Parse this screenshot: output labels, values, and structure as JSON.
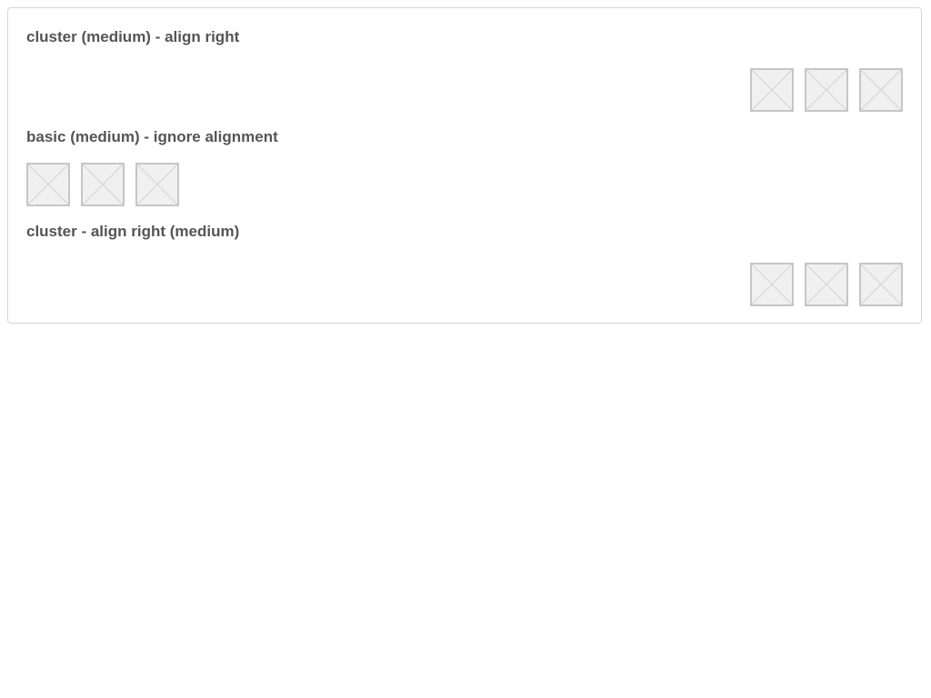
{
  "sections": [
    {
      "title": "cluster (medium) - align right",
      "items": [
        {
          "icon": "image-placeholder-icon"
        },
        {
          "icon": "image-placeholder-icon"
        },
        {
          "icon": "image-placeholder-icon"
        }
      ]
    },
    {
      "title": "basic (medium) - ignore alignment",
      "items": [
        {
          "icon": "image-placeholder-icon"
        },
        {
          "icon": "image-placeholder-icon"
        },
        {
          "icon": "image-placeholder-icon"
        }
      ]
    },
    {
      "title": "cluster - align right (medium)",
      "items": [
        {
          "icon": "image-placeholder-icon"
        },
        {
          "icon": "image-placeholder-icon"
        },
        {
          "icon": "image-placeholder-icon"
        }
      ]
    }
  ],
  "colors": {
    "title_text": "#555555",
    "card_border": "#d6d6d6",
    "placeholder_border": "#c6c6c6",
    "placeholder_fill": "#f0f0f0"
  }
}
